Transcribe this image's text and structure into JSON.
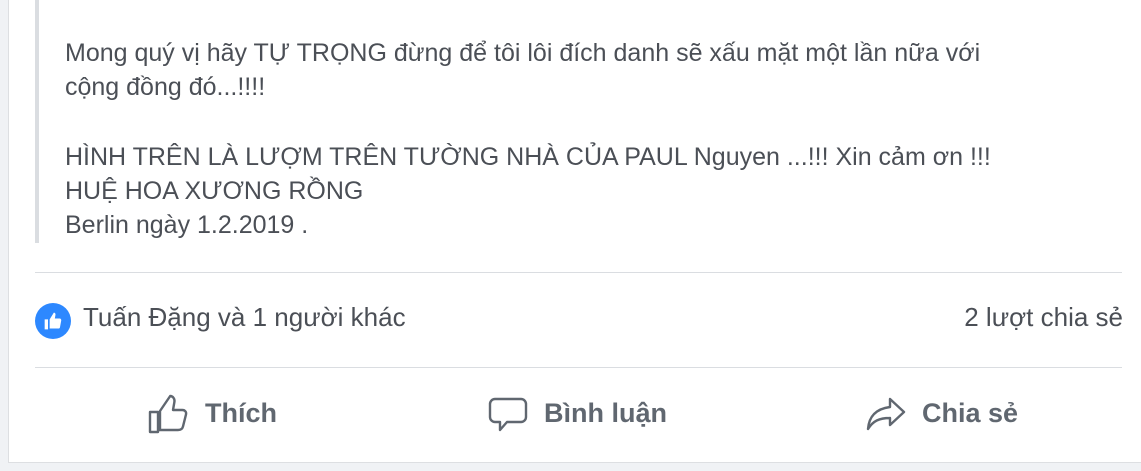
{
  "post": {
    "paragraphs": [
      [
        "Mong quý vị hãy TỰ TRỌNG đừng để tôi lôi đích danh sẽ xấu mặt một lần nữa với",
        "cộng đồng đó...!!!!"
      ],
      [
        "HÌNH TRÊN LÀ LƯỢM TRÊN TƯỜNG NHÀ CỦA PAUL Nguyen ...!!! Xin cảm ơn !!!",
        "HUỆ HOA XƯƠNG RỒNG",
        "Berlin ngày 1.2.2019 ."
      ]
    ]
  },
  "reactions": {
    "reactors_text": "Tuấn Đặng và 1 người khác",
    "shares_text": "2 lượt chia sẻ",
    "icon": "like-icon",
    "icon_color": "#2d88ff"
  },
  "actions": {
    "like_label": "Thích",
    "comment_label": "Bình luận",
    "share_label": "Chia sẻ"
  },
  "colors": {
    "text": "#4b4f56",
    "action_text": "#606770",
    "quote_bar": "#dadde1"
  }
}
